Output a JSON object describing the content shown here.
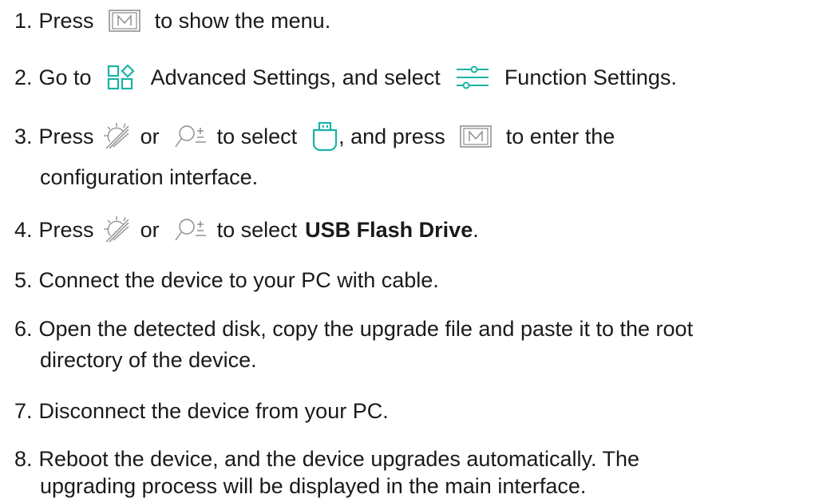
{
  "colors": {
    "text": "#1a1a1a",
    "teal_icon": "#1ab3a6",
    "gray_icon": "#8a8a8a"
  },
  "icons": {
    "m_button": "m-button-icon",
    "advanced_settings": "advanced-settings-icon",
    "function_settings": "function-settings-icon",
    "brightness": "brightness-icon",
    "zoom": "zoom-icon",
    "usb": "usb-icon"
  },
  "steps": [
    {
      "num": "1.",
      "parts": {
        "a": "Press",
        "b": "to show the menu."
      }
    },
    {
      "num": "2.",
      "parts": {
        "a": "Go to",
        "b": "Advanced Settings, and select",
        "c": "Function Settings."
      }
    },
    {
      "num": "3.",
      "parts": {
        "a": "Press",
        "b": "or",
        "c": "to select",
        "d": ", and press",
        "e": "to enter the"
      },
      "cont": "configuration interface."
    },
    {
      "num": "4.",
      "parts": {
        "a": "Press",
        "b": "or",
        "c": "to select",
        "d": "USB Flash Drive",
        "e": "."
      }
    },
    {
      "num": "5.",
      "parts": {
        "a": "Connect the device to your PC with cable."
      }
    },
    {
      "num": "6.",
      "parts": {
        "a": "Open the detected disk, copy the upgrade file and paste it to the root"
      },
      "cont": "directory of the device."
    },
    {
      "num": "7.",
      "parts": {
        "a": "Disconnect the device from your PC."
      }
    },
    {
      "num": "8.",
      "parts": {
        "a": "Reboot the device, and the device upgrades automatically. The"
      },
      "cont": "upgrading process will be displayed in the main interface."
    }
  ]
}
